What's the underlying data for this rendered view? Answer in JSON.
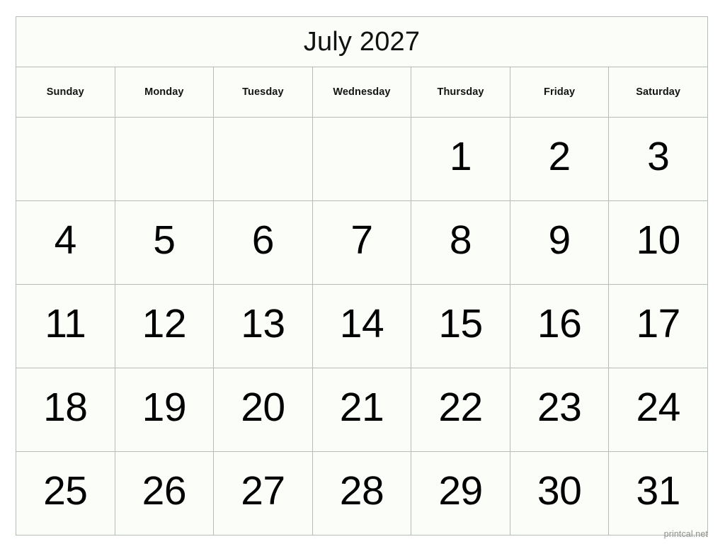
{
  "calendar": {
    "title": "July 2027",
    "month": "July",
    "year": "2027",
    "weekday_headers": [
      "Sunday",
      "Monday",
      "Tuesday",
      "Wednesday",
      "Thursday",
      "Friday",
      "Saturday"
    ],
    "weeks": [
      [
        "",
        "",
        "",
        "",
        "1",
        "2",
        "3"
      ],
      [
        "4",
        "5",
        "6",
        "7",
        "8",
        "9",
        "10"
      ],
      [
        "11",
        "12",
        "13",
        "14",
        "15",
        "16",
        "17"
      ],
      [
        "18",
        "19",
        "20",
        "21",
        "22",
        "23",
        "24"
      ],
      [
        "25",
        "26",
        "27",
        "28",
        "29",
        "30",
        "31"
      ]
    ]
  },
  "footer": {
    "credit": "printcal.net"
  },
  "colors": {
    "page_background": "#ffffff",
    "cell_background": "#fbfdf9",
    "grid_line": "#b8bcb6",
    "title_text": "#111111",
    "header_text": "#141414",
    "day_text": "#000000",
    "credit_text": "#8e918c"
  }
}
